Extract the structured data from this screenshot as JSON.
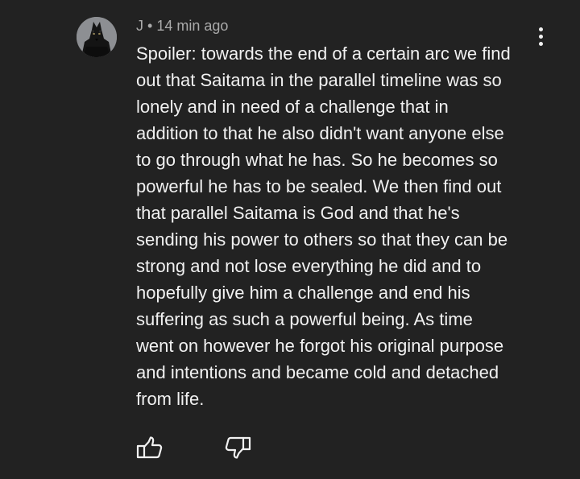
{
  "comment": {
    "author": "J",
    "separator": "•",
    "timestamp": "14 min ago",
    "avatar": "wolf-avatar",
    "text": "Spoiler: towards the end of a certain arc we find\nout that Saitama in the parallel timeline was so\nlonely and in need of a challenge that in\naddition to that he also didn't want anyone else\nto go through what he has. So he becomes so\npowerful he has to be sealed. We then find out\nthat parallel Saitama is God and that he's\nsending his power to others so that they can be\nstrong and not lose everything he did and to\nhopefully give him a challenge and end his\nsuffering as such a powerful being. As time\nwent on however he forgot his original purpose\nand intentions and became cold and detached\nfrom life.",
    "actions": {
      "like_icon": "thumbs-up-icon",
      "dislike_icon": "thumbs-down-icon",
      "menu_icon": "more-vertical-icon"
    }
  },
  "colors": {
    "background": "#222222",
    "text": "#f1f1f1",
    "meta": "#aaaaaa"
  }
}
